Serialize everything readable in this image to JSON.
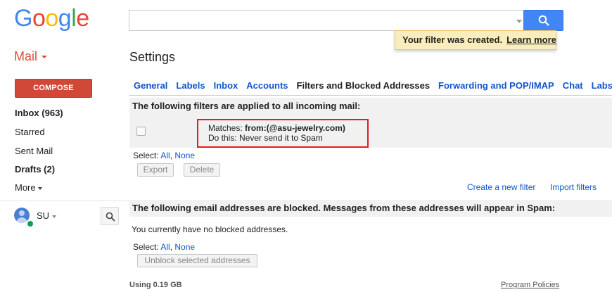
{
  "brand": {
    "logo_letters": [
      {
        "ch": "G",
        "color": "#4285f4"
      },
      {
        "ch": "o",
        "color": "#ea4335"
      },
      {
        "ch": "o",
        "color": "#fbbc05"
      },
      {
        "ch": "g",
        "color": "#4285f4"
      },
      {
        "ch": "l",
        "color": "#34a853"
      },
      {
        "ch": "e",
        "color": "#ea4335"
      }
    ]
  },
  "search": {
    "value": "",
    "placeholder": ""
  },
  "toast": {
    "message": "Your filter was created.",
    "link": "Learn more"
  },
  "nav": {
    "app_label": "Mail",
    "compose_label": "COMPOSE",
    "items": [
      {
        "label": "Inbox (963)",
        "bold": true
      },
      {
        "label": "Starred",
        "bold": false
      },
      {
        "label": "Sent Mail",
        "bold": false
      },
      {
        "label": "Drafts (2)",
        "bold": true
      },
      {
        "label": "More",
        "bold": false
      }
    ],
    "user": "SU"
  },
  "settings": {
    "title": "Settings",
    "tabs": [
      {
        "label": "General",
        "active": false
      },
      {
        "label": "Labels",
        "active": false
      },
      {
        "label": "Inbox",
        "active": false
      },
      {
        "label": "Accounts",
        "active": false
      },
      {
        "label": "Filters and Blocked Addresses",
        "active": true
      },
      {
        "label": "Forwarding and POP/IMAP",
        "active": false
      },
      {
        "label": "Chat",
        "active": false
      },
      {
        "label": "Labs",
        "active": false
      }
    ]
  },
  "filters": {
    "header": "The following filters are applied to all incoming mail:",
    "items": [
      {
        "matches_label": "Matches:",
        "matches_value": "from:(@asu-jewelry.com)",
        "action_label": "Do this:",
        "action_value": "Never send it to Spam"
      }
    ],
    "select_label": "Select:",
    "select_all": "All",
    "select_none": "None",
    "export_label": "Export",
    "delete_label": "Delete",
    "create_link": "Create a new filter",
    "import_link": "Import filters"
  },
  "blocked": {
    "header": "The following email addresses are blocked. Messages from these addresses will appear in Spam:",
    "empty_text": "You currently have no blocked addresses.",
    "select_label": "Select:",
    "select_all": "All",
    "select_none": "None",
    "unblock_label": "Unblock selected addresses"
  },
  "footer": {
    "usage": "Using 0.19 GB",
    "policy": "Program Policies"
  },
  "colors": {
    "accent_red": "#dd4b39",
    "compose_bg": "#d14836",
    "search_blue": "#4285f4",
    "link_blue": "#1155cc",
    "toast_bg": "#f9edbe",
    "highlight_border": "#e02020"
  }
}
